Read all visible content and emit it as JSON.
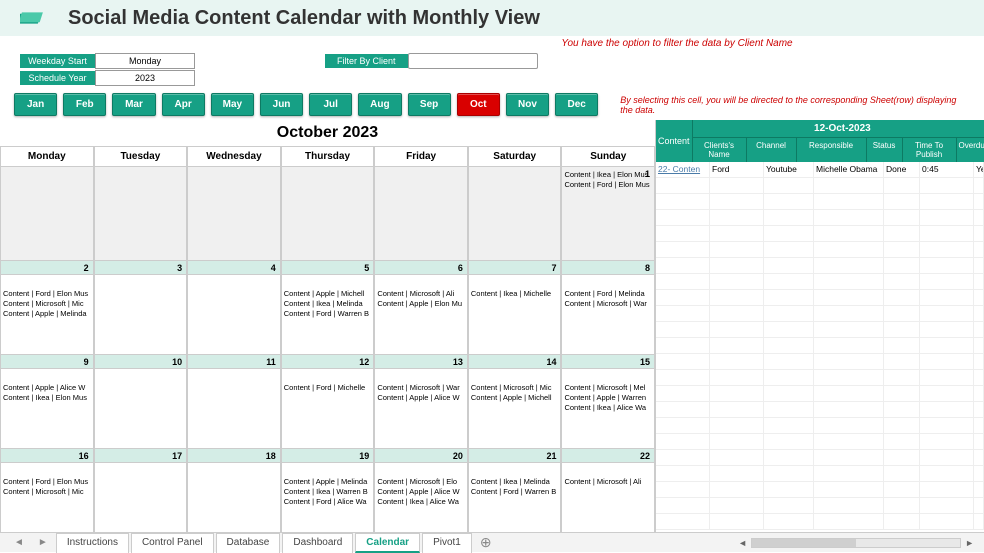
{
  "header": {
    "title": "Social Media Content Calendar with Monthly View"
  },
  "filter_note": "You have the option to filter the data by Client Name",
  "controls": {
    "weekday_label": "Weekday Start",
    "weekday_value": "Monday",
    "year_label": "Schedule Year",
    "year_value": "2023",
    "filter_label": "Filter By Client",
    "filter_value": ""
  },
  "months": [
    "Jan",
    "Feb",
    "Mar",
    "Apr",
    "May",
    "Jun",
    "Jul",
    "Aug",
    "Sep",
    "Oct",
    "Nov",
    "Dec"
  ],
  "active_month_index": 9,
  "select_note": "By selecting this cell, you will be directed to the corresponding Sheet(row) displaying the data.",
  "calendar": {
    "title": "October 2023",
    "weekdays": [
      "Monday",
      "Tuesday",
      "Wednesday",
      "Thursday",
      "Friday",
      "Saturday",
      "Sunday"
    ],
    "rows": [
      [
        {
          "date": "",
          "dim": true,
          "items": []
        },
        {
          "date": "",
          "dim": true,
          "items": []
        },
        {
          "date": "",
          "dim": true,
          "items": []
        },
        {
          "date": "",
          "dim": true,
          "items": []
        },
        {
          "date": "",
          "dim": true,
          "items": []
        },
        {
          "date": "",
          "dim": true,
          "items": []
        },
        {
          "date": "1",
          "dim": true,
          "items": [
            "Content | Ikea | Elon Mus",
            "Content | Ford | Elon Mus"
          ]
        }
      ],
      [
        {
          "date": "2",
          "items": [
            "Content | Ford | Elon Mus",
            "Content | Microsoft | Mic",
            "Content | Apple | Melinda"
          ]
        },
        {
          "date": "3",
          "items": []
        },
        {
          "date": "4",
          "items": []
        },
        {
          "date": "5",
          "items": [
            "Content | Apple | Michell",
            "Content | Ikea | Melinda",
            "Content | Ford | Warren B"
          ]
        },
        {
          "date": "6",
          "items": [
            "Content | Microsoft | Ali",
            "Content | Apple | Elon Mu"
          ]
        },
        {
          "date": "7",
          "items": [
            "Content | Ikea | Michelle"
          ]
        },
        {
          "date": "8",
          "items": [
            "Content | Ford | Melinda",
            "Content | Microsoft | War"
          ]
        }
      ],
      [
        {
          "date": "9",
          "items": [
            "Content | Apple | Alice W",
            "Content | Ikea | Elon Mus"
          ]
        },
        {
          "date": "10",
          "items": []
        },
        {
          "date": "11",
          "items": []
        },
        {
          "date": "12",
          "items": [
            "Content | Ford | Michelle"
          ]
        },
        {
          "date": "13",
          "items": [
            "Content | Microsoft | War",
            "Content | Apple | Alice W"
          ]
        },
        {
          "date": "14",
          "items": [
            "Content | Microsoft | Mic",
            "Content | Apple | Michell"
          ]
        },
        {
          "date": "15",
          "items": [
            "Content | Microsoft | Mel",
            "Content | Apple | Warren",
            "Content | Ikea | Alice Wa"
          ]
        }
      ],
      [
        {
          "date": "16",
          "items": [
            "Content | Ford | Elon Mus",
            "Content | Microsoft | Mic"
          ]
        },
        {
          "date": "17",
          "items": []
        },
        {
          "date": "18",
          "items": []
        },
        {
          "date": "19",
          "items": [
            "Content | Apple | Melinda",
            "Content | Ikea | Warren B",
            "Content | Ford | Alice Wa"
          ]
        },
        {
          "date": "20",
          "items": [
            "Content | Microsoft | Elo",
            "Content | Apple | Alice W",
            "Content | Ikea | Alice Wa"
          ]
        },
        {
          "date": "21",
          "items": [
            "Content | Ikea | Melinda",
            "Content | Ford | Warren B"
          ]
        },
        {
          "date": "22",
          "items": [
            "Content | Microsoft | Ali"
          ]
        }
      ]
    ]
  },
  "side": {
    "content_hdr": "Content",
    "date": "12-Oct-2023",
    "cols": {
      "client": "Clients's Name",
      "channel": "Channel",
      "responsible": "Responsible",
      "status": "Status",
      "time": "Time To Publish",
      "overdue": "Overdue"
    },
    "rows": [
      {
        "content": "22- Conten",
        "client": "Ford",
        "channel": "Youtube",
        "responsible": "Michelle Obama",
        "status": "Done",
        "time": "0:45",
        "overdue": "Yes"
      }
    ],
    "empty_rows": 22
  },
  "tabs": [
    "Instructions",
    "Control Panel",
    "Database",
    "Dashboard",
    "Calendar",
    "Pivot1"
  ],
  "active_tab_index": 4
}
